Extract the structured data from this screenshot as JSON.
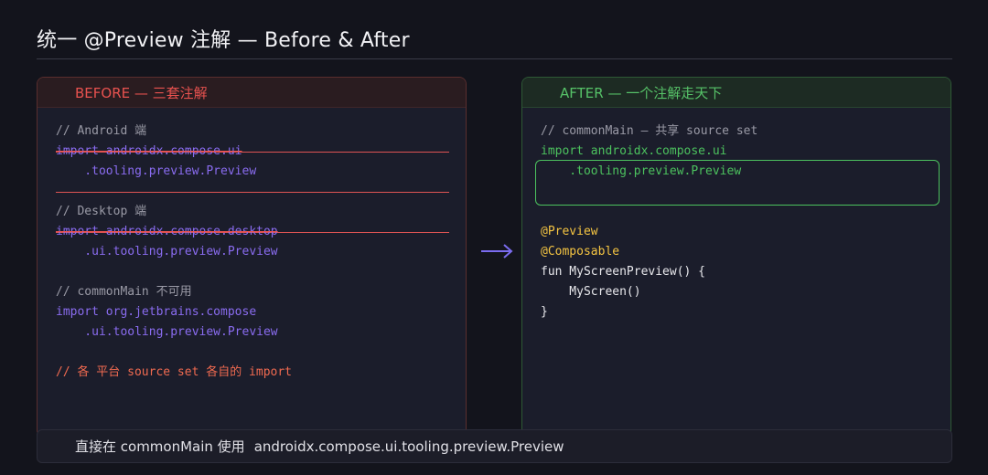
{
  "title": "统一 @Preview 注解 — Before & After",
  "before": {
    "header": "BEFORE — 三套注解",
    "lines": [
      "// Android 端",
      "import androidx.compose.ui",
      "    .tooling.preview.Preview",
      "// Desktop 端",
      "import androidx.compose.desktop",
      "    .ui.tooling.preview.Preview",
      "// commonMain 不可用",
      "import org.jetbrains.compose",
      "    .ui.tooling.preview.Preview",
      "// 各 平台 source set 各自的 import"
    ]
  },
  "after": {
    "header": "AFTER — 一个注解走天下",
    "lines": [
      "// commonMain — 共享 source set",
      "import androidx.compose.ui",
      "    .tooling.preview.Preview",
      "@Preview",
      "@Composable",
      "fun MyScreenPreview() {",
      "    MyScreen()",
      "}"
    ]
  },
  "footer": {
    "text": "直接在 commonMain 使用",
    "package": "androidx.compose.ui.tooling.preview.Preview"
  },
  "colors": {
    "before_accent": "#e8524f",
    "after_accent": "#56c268",
    "keyword": "#8a6cf0",
    "annotation": "#f5c542",
    "arrow": "#7b6cf0"
  },
  "icons": {
    "arrow": "arrow-right-icon"
  }
}
